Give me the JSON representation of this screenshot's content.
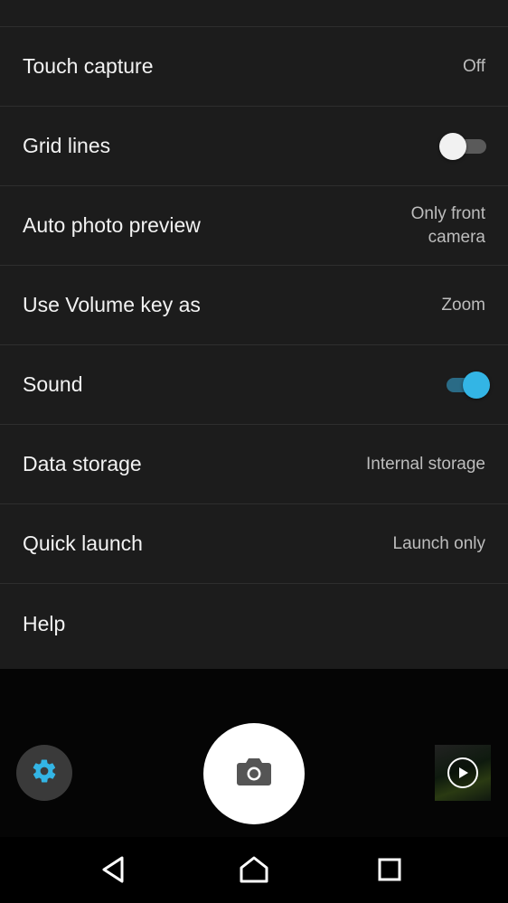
{
  "settings": {
    "items": [
      {
        "label": "Touch capture",
        "value": "Off"
      },
      {
        "label": "Grid lines",
        "toggle": "off"
      },
      {
        "label": "Auto photo preview",
        "value": "Only front camera"
      },
      {
        "label": "Use Volume key as",
        "value": "Zoom"
      },
      {
        "label": "Sound",
        "toggle": "on"
      },
      {
        "label": "Data storage",
        "value": "Internal storage"
      },
      {
        "label": "Quick launch",
        "value": "Launch only"
      },
      {
        "label": "Help"
      }
    ]
  },
  "camera_controls": {
    "settings_icon": "gear-icon",
    "shutter_icon": "camera-icon",
    "thumbnail_icon": "play-icon"
  },
  "navbar": {
    "back_icon": "back-icon",
    "home_icon": "home-icon",
    "recents_icon": "recents-icon"
  },
  "colors": {
    "accent": "#33b5e5",
    "panel_background": "#1c1c1c",
    "divider": "#2e2e2e"
  }
}
